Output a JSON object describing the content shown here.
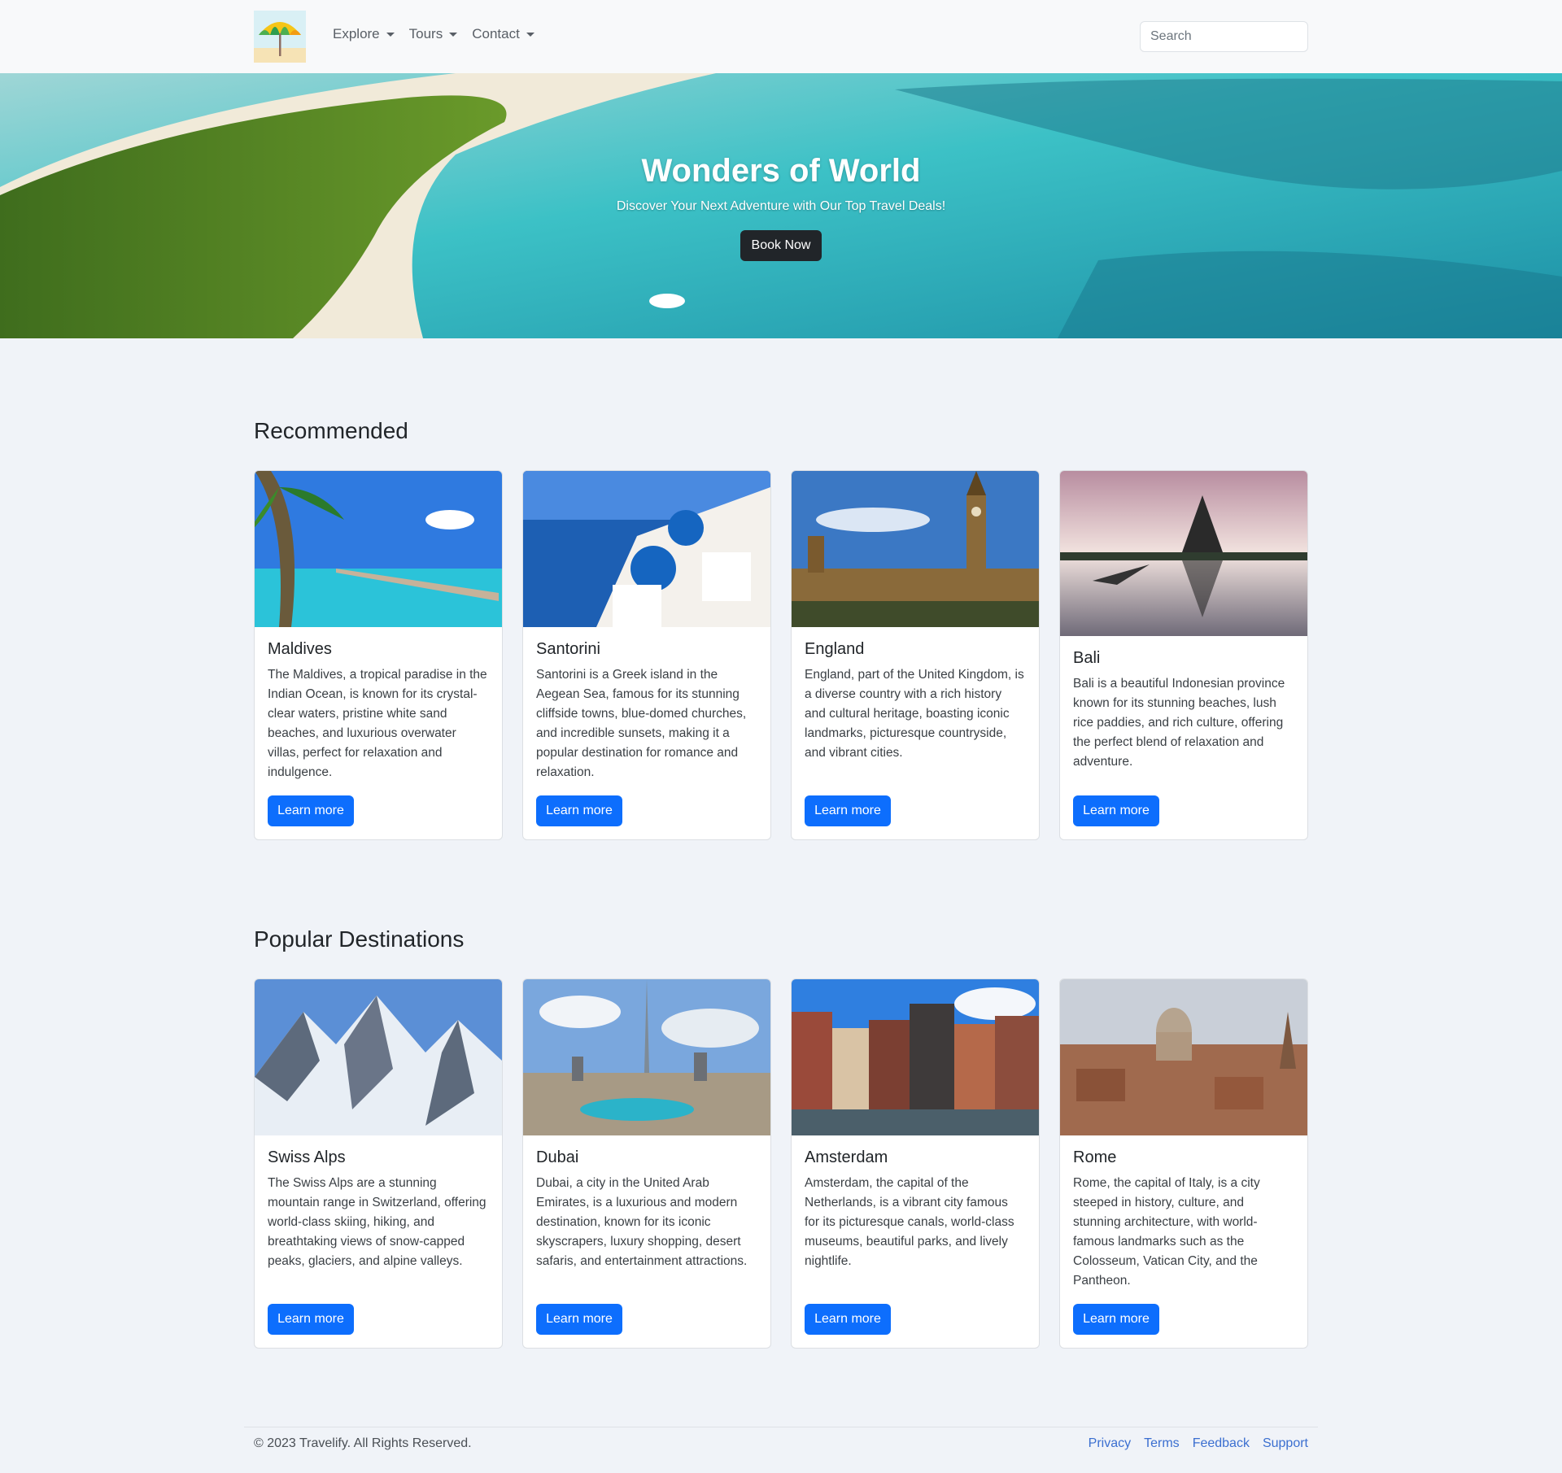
{
  "nav": {
    "logo_icon": "beach-umbrella-icon",
    "links": [
      {
        "label": "Explore"
      },
      {
        "label": "Tours"
      },
      {
        "label": "Contact"
      }
    ],
    "search_placeholder": "Search"
  },
  "hero": {
    "title": "Wonders of World",
    "subtitle": "Discover Your Next Adventure with Our Top Travel Deals!",
    "button": "Book Now"
  },
  "recommended": {
    "title": "Recommended",
    "cards": [
      {
        "title": "Maldives",
        "text": "The Maldives, a tropical paradise in the Indian Ocean, is known for its crystal-clear waters, pristine white sand beaches, and luxurious overwater villas, perfect for relaxation and indulgence.",
        "button": "Learn more"
      },
      {
        "title": "Santorini",
        "text": "Santorini is a Greek island in the Aegean Sea, famous for its stunning cliffside towns, blue-domed churches, and incredible sunsets, making it a popular destination for romance and relaxation.",
        "button": "Learn more"
      },
      {
        "title": "England",
        "text": "England, part of the United Kingdom, is a diverse country with a rich history and cultural heritage, boasting iconic landmarks, picturesque countryside, and vibrant cities.",
        "button": "Learn more"
      },
      {
        "title": "Bali",
        "text": "Bali is a beautiful Indonesian province known for its stunning beaches, lush rice paddies, and rich culture, offering the perfect blend of relaxation and adventure.",
        "button": "Learn more"
      }
    ]
  },
  "popular": {
    "title": "Popular Destinations",
    "cards": [
      {
        "title": "Swiss Alps",
        "text": "The Swiss Alps are a stunning mountain range in Switzerland, offering world-class skiing, hiking, and breathtaking views of snow-capped peaks, glaciers, and alpine valleys.",
        "button": "Learn more"
      },
      {
        "title": "Dubai",
        "text": "Dubai, a city in the United Arab Emirates, is a luxurious and modern destination, known for its iconic skyscrapers, luxury shopping, desert safaris, and entertainment attractions.",
        "button": "Learn more"
      },
      {
        "title": "Amsterdam",
        "text": "Amsterdam, the capital of the Netherlands, is a vibrant city famous for its picturesque canals, world-class museums, beautiful parks, and lively nightlife.",
        "button": "Learn more"
      },
      {
        "title": "Rome",
        "text": "Rome, the capital of Italy, is a city steeped in history, culture, and stunning architecture, with world-famous landmarks such as the Colosseum, Vatican City, and the Pantheon.",
        "button": "Learn more"
      }
    ]
  },
  "footer": {
    "copyright": "© 2023 Travelify. All Rights Reserved.",
    "links": [
      {
        "label": "Privacy"
      },
      {
        "label": "Terms"
      },
      {
        "label": "Feedback"
      },
      {
        "label": "Support"
      }
    ]
  },
  "colors": {
    "primary": "#0d6efd",
    "dark": "#212529",
    "page_bg": "#f0f3f8",
    "nav_bg": "#f8f9fa"
  }
}
